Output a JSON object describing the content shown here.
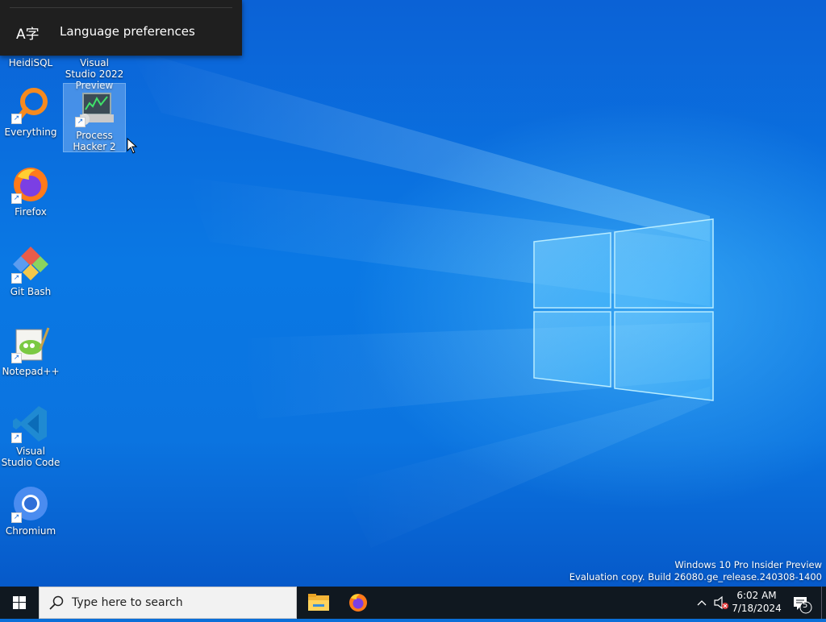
{
  "desktop": {
    "icons": [
      {
        "label": "HeidiSQL"
      },
      {
        "label": "Visual Studio 2022 Preview"
      },
      {
        "label": "Everything"
      },
      {
        "label": "Process Hacker 2"
      },
      {
        "label": "Firefox"
      },
      {
        "label": "Git Bash"
      },
      {
        "label": "Notepad++"
      },
      {
        "label": "Visual Studio Code"
      },
      {
        "label": "Chromium"
      }
    ]
  },
  "popup": {
    "label": "Language preferences"
  },
  "watermark": {
    "line1": "Windows 10 Pro Insider Preview",
    "line2": "Evaluation copy. Build 26080.ge_release.240308-1400"
  },
  "taskbar": {
    "search_placeholder": "Type here to search",
    "time": "6:02 AM",
    "date": "7/18/2024",
    "notification_count": "5"
  },
  "colors": {
    "desktop_blue": "#0a6fd8",
    "taskbar": "#101820",
    "popup": "#1f1f1f"
  }
}
